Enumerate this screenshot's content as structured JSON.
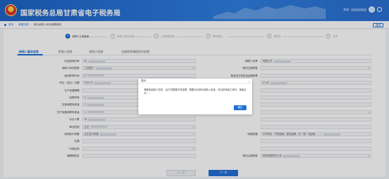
{
  "header": {
    "title": "国家税务总局甘肃省电子税务局",
    "greeting": "欢迎"
  },
  "breadcrumb": {
    "items": [
      "首页",
      "我要办税",
      "新办纳税人综合套餐服务"
    ],
    "back_label": "返回"
  },
  "steps": [
    {
      "num": "1",
      "label": "纳税人工商信息",
      "active": true
    },
    {
      "num": "2",
      "label": "纳税人登记信息"
    },
    {
      "num": "3",
      "label": "上传附报资料"
    },
    {
      "num": "4",
      "label": "预览提交"
    },
    {
      "num": "5",
      "label": "审核中"
    },
    {
      "num": "6",
      "label": "完成"
    }
  ],
  "tabs": [
    "纳税人基本信息",
    "负责人信息",
    "投资人信息",
    "注册资本和投资方信息"
  ],
  "form": {
    "left": [
      {
        "label": "社会信用代码",
        "required": true,
        "value": "91"
      },
      {
        "label": "纳税人状态类型",
        "required": false,
        "value": "工商登记",
        "select": true
      },
      {
        "label": "组织机构代码",
        "required": false,
        "value": "9"
      },
      {
        "label": "开业（设立）日期",
        "required": true,
        "value": "2022-07"
      },
      {
        "label": "生产经营期限",
        "required": false,
        "value": ""
      },
      {
        "label": "证照号码",
        "required": true,
        "value": "9"
      },
      {
        "label": "注册地联系电话",
        "required": true,
        "value": "1"
      },
      {
        "label": "生产经营地联系电话",
        "required": true,
        "value": "1"
      },
      {
        "label": "从业人数",
        "required": true,
        "value": "30"
      },
      {
        "label": "单位性质",
        "required": true,
        "value": "企业",
        "select": true
      },
      {
        "label": "适用会计制度",
        "required": true,
        "value": "企业会计制度",
        "select": true
      },
      {
        "label": "主管",
        "required": true,
        "value": ""
      },
      {
        "label": "行政区划",
        "required": true,
        "value": "",
        "select": true
      },
      {
        "label": "管理机构名",
        "required": false,
        "value": ""
      }
    ],
    "right": [
      {
        "label": "纳税人名称",
        "required": true,
        "value": "有限公司"
      },
      {
        "label": "登记注册类型",
        "required": true,
        "value": "",
        "select": true
      },
      {
        "label": "批准设立机关及证照种类",
        "required": false,
        "value": ""
      },
      {
        "label": "",
        "required": false,
        "value": "07-25"
      },
      {
        "label": "",
        "required": false,
        "value": ""
      },
      {
        "label": "",
        "required": false,
        "value": ""
      },
      {
        "label": "",
        "required": false,
        "value": ""
      },
      {
        "label": "",
        "required": false,
        "value": "",
        "select": true
      },
      {
        "label": "",
        "required": false,
        "value": ""
      },
      {
        "label": "",
        "required": false,
        "value": ""
      },
      {
        "label": "经营范围",
        "required": true,
        "value": "许可项目：货物运输、船舶运输、供（电）电运输、……"
      },
      {
        "label": "",
        "required": false,
        "value": ""
      },
      {
        "label": "",
        "required": false,
        "value": ""
      },
      {
        "label": "登记注册类型",
        "required": true,
        "value": "其他有限责任公司",
        "select": true
      }
    ]
  },
  "buttons": {
    "prev": "上一步",
    "next": "下一步"
  },
  "modal": {
    "title": "提示",
    "message": "尊敬的纳税人您好，由于您需要开具发票，需要补充填写纳税人信息，请当前有能力填写，谢谢合作……",
    "ok": "确定"
  },
  "colors": {
    "primary": "#1f6fd6",
    "header": "#2a6fd2",
    "required": "#e23a3a"
  }
}
